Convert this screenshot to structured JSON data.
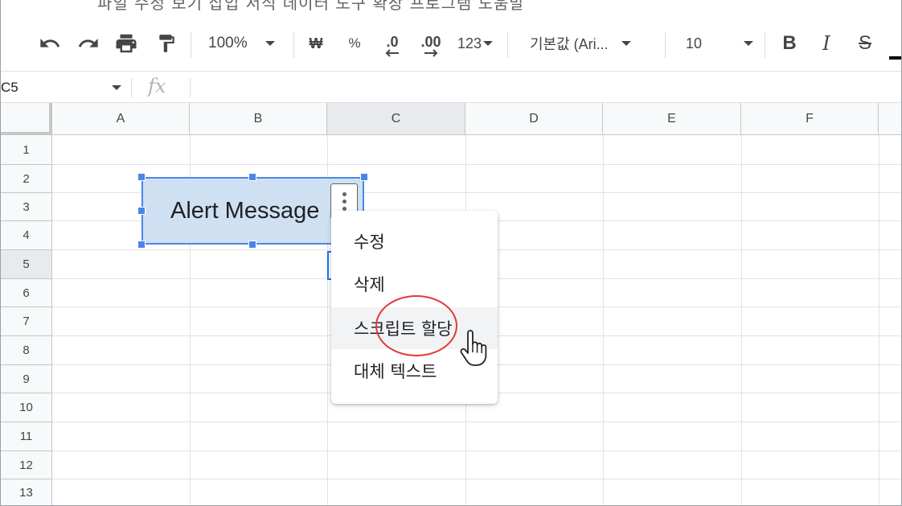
{
  "menu": {
    "cropped_text": "파일  수정  보기  삽입  서식  데이터  도구  확장 프로그램  도움말"
  },
  "toolbar": {
    "zoom": "100%",
    "currency": "₩",
    "percent": "%",
    "decrease_decimal": ".0",
    "increase_decimal": ".00",
    "number_format": "123",
    "font": "기본값 (Ari...",
    "font_size": "10",
    "bold": "B",
    "italic": "I",
    "strikethrough": "S"
  },
  "formula_bar": {
    "cell_ref": "C5",
    "fx": "fx"
  },
  "columns": [
    "A",
    "B",
    "C",
    "D",
    "E",
    "F"
  ],
  "rows": [
    "1",
    "2",
    "3",
    "4",
    "5",
    "6",
    "7",
    "8",
    "9",
    "10",
    "11",
    "12",
    "13"
  ],
  "active": {
    "column": "C",
    "row": "5"
  },
  "drawing": {
    "label": "Alert Message"
  },
  "context_menu": {
    "items": [
      {
        "label": "수정"
      },
      {
        "label": "삭제"
      },
      {
        "label": "스크립트 할당"
      },
      {
        "label": "대체 텍스트"
      }
    ],
    "hovered_index": 2
  },
  "colors": {
    "selection_blue": "#4a86e8",
    "drawing_fill": "#cfe0f2",
    "annotation_red": "#e53935",
    "header_bg": "#f8f9fa"
  }
}
